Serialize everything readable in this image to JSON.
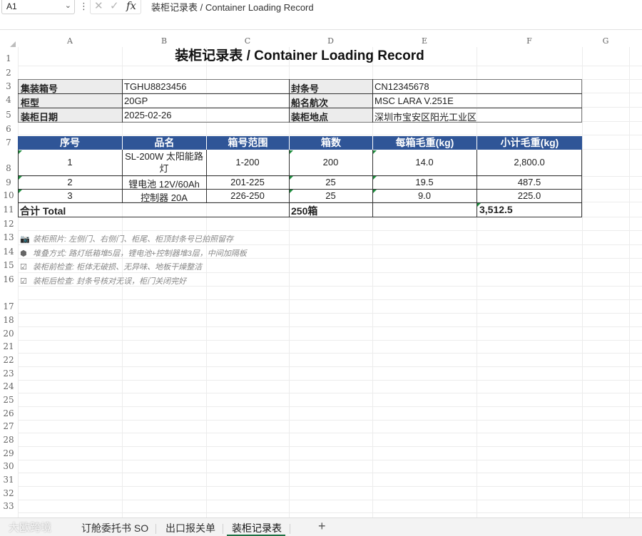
{
  "formula_bar": {
    "cell_ref": "A1",
    "formula": "装柜记录表 / Container Loading Record",
    "fx_label": "fx"
  },
  "columns": [
    "A",
    "B",
    "C",
    "D",
    "E",
    "F",
    "G"
  ],
  "rows": [
    "1",
    "2",
    "3",
    "4",
    "5",
    "6",
    "7",
    "8",
    "9",
    "10",
    "11",
    "12",
    "13",
    "14",
    "15",
    "16",
    "17",
    "18",
    "19",
    "20",
    "21",
    "22",
    "23",
    "24",
    "25",
    "26",
    "27",
    "28",
    "29",
    "30",
    "31",
    "32",
    "33"
  ],
  "sheet": {
    "title": "装柜记录表 / Container Loading Record",
    "info": {
      "container_no_label": "集装箱号",
      "container_no": "TGHU8823456",
      "seal_no_label": "封条号",
      "seal_no": "CN12345678",
      "type_label": "柜型",
      "type": "20GP",
      "vessel_label": "船名航次",
      "vessel": "MSC LARA V.251E",
      "date_label": "装柜日期",
      "date": "2025-02-26",
      "place_label": "装柜地点",
      "place": "深圳市宝安区阳光工业区"
    },
    "table": {
      "headers": [
        "序号",
        "品名",
        "箱号范围",
        "箱数",
        "每箱毛重(kg)",
        "小计毛重(kg)"
      ],
      "rows": [
        {
          "no": "1",
          "name_l1": "SL-200W 太阳能路",
          "name_l2": "灯",
          "range": "1-200",
          "count": "200",
          "unit_wt": "14.0",
          "sub_wt": "2,800.0"
        },
        {
          "no": "2",
          "name_l1": "锂电池 12V/60Ah",
          "name_l2": "",
          "range": "201-225",
          "count": "25",
          "unit_wt": "19.5",
          "sub_wt": "487.5"
        },
        {
          "no": "3",
          "name_l1": "控制器 20A",
          "name_l2": "",
          "range": "226-250",
          "count": "25",
          "unit_wt": "9.0",
          "sub_wt": "225.0"
        }
      ],
      "total_label": "合计 Total",
      "total_count": "250箱",
      "total_weight": "3,512.5"
    },
    "notes": [
      {
        "icon": "camera-icon",
        "text": "装柜照片: 左侧门、右侧门、柜尾、柜顶封条号已拍照留存"
      },
      {
        "icon": "box-icon",
        "text": "堆叠方式: 路灯纸箱堆5层，锂电池+控制器堆3层，中间加隔板"
      },
      {
        "icon": "checkbox-icon",
        "text": "装柜前检查: 柜体无破损、无异味、地板干燥整洁"
      },
      {
        "icon": "checkbox-icon",
        "text": "装柜后检查: 封条号核对无误，柜门关闭完好"
      }
    ]
  },
  "tabs": [
    {
      "label": "订舱委托书 SO",
      "active": false
    },
    {
      "label": "出口报关单",
      "active": false
    },
    {
      "label": "装柜记录表",
      "active": true
    }
  ],
  "add_tab_label": "+",
  "watermark": "大欧跨境",
  "colors": {
    "header_blue": "#2f5597",
    "label_gray": "#ececec",
    "active_tab_green": "#1e7145"
  }
}
